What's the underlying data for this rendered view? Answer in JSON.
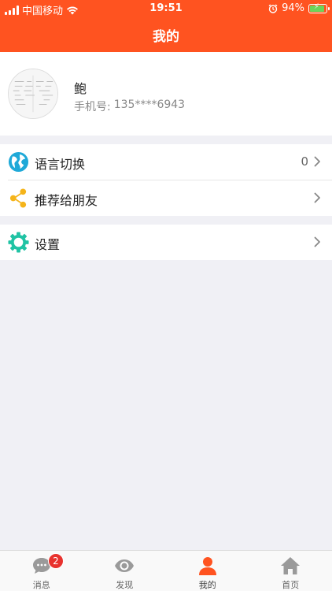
{
  "status_bar": {
    "carrier": "中国移动",
    "time": "19:51",
    "battery_percent": "94%",
    "battery_level": 0.94
  },
  "nav": {
    "title": "我的"
  },
  "profile": {
    "name": "鲍",
    "phone_label": "手机号:",
    "phone_value": "135****6943"
  },
  "menu": {
    "language": {
      "label": "语言切换",
      "value": "0",
      "icon": "globe-icon"
    },
    "share": {
      "label": "推荐给朋友",
      "icon": "share-icon"
    },
    "settings": {
      "label": "设置",
      "icon": "gear-icon"
    }
  },
  "tabs": [
    {
      "label": "消息",
      "icon": "chat-icon",
      "badge": "2"
    },
    {
      "label": "发现",
      "icon": "eye-icon"
    },
    {
      "label": "我的",
      "icon": "person-icon"
    },
    {
      "label": "首页",
      "icon": "home-icon"
    }
  ],
  "colors": {
    "brand": "#ff5320",
    "globe": "#1fa9d8",
    "share": "#f5b41a",
    "gear": "#20c3a4",
    "badge": "#e8322e"
  }
}
